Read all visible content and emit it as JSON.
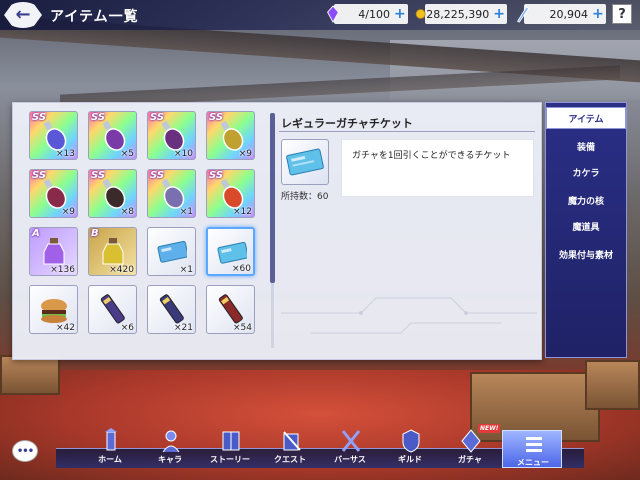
{
  "header": {
    "title": "アイテム一覧",
    "back_icon": "back-arrow-icon"
  },
  "resources": [
    {
      "icon": "crystal-icon",
      "value": "4/100",
      "color": "#8b4bff"
    },
    {
      "icon": "coin-icon",
      "value": "28,225,390",
      "color": "#f0c020"
    },
    {
      "icon": "gem-icon",
      "value": "20,904",
      "color": "#7fb0ff"
    }
  ],
  "help_label": "?",
  "grid": {
    "items": [
      {
        "rank": "SS",
        "qty": "×13",
        "bg": "rainbow",
        "art": "potion-ring"
      },
      {
        "rank": "SS",
        "qty": "×5",
        "bg": "rainbow",
        "art": "potion-wing"
      },
      {
        "rank": "SS",
        "qty": "×10",
        "bg": "rainbow",
        "art": "potion-sword"
      },
      {
        "rank": "SS",
        "qty": "×9",
        "bg": "rainbow",
        "art": "potion-orb"
      },
      {
        "rank": "SS",
        "qty": "×9",
        "bg": "rainbow",
        "art": "potion-staff"
      },
      {
        "rank": "SS",
        "qty": "×8",
        "bg": "rainbow",
        "art": "potion-dark"
      },
      {
        "rank": "SS",
        "qty": "×1",
        "bg": "rainbow",
        "art": "potion-silver"
      },
      {
        "rank": "SS",
        "qty": "×12",
        "bg": "rainbow",
        "art": "potion-red"
      },
      {
        "rank": "A",
        "qty": "×136",
        "bg": "purple",
        "art": "bottle-purple"
      },
      {
        "rank": "B",
        "qty": "×420",
        "bg": "gold",
        "art": "bottle-yellow"
      },
      {
        "rank": "",
        "qty": "×1",
        "bg": "plain",
        "art": "ticket-blue"
      },
      {
        "rank": "",
        "qty": "×60",
        "bg": "plain",
        "art": "ticket-cyan",
        "selected": true
      },
      {
        "rank": "",
        "qty": "×42",
        "bg": "plain",
        "art": "burger"
      },
      {
        "rank": "",
        "qty": "×6",
        "bg": "plain",
        "art": "tube-purple"
      },
      {
        "rank": "",
        "qty": "×21",
        "bg": "plain",
        "art": "tube-blue"
      },
      {
        "rank": "",
        "qty": "×54",
        "bg": "plain",
        "art": "tube-red"
      }
    ]
  },
  "detail": {
    "title": "レギュラーガチャチケット",
    "count": "所持数：60",
    "description": "ガチャを1回引くことができるチケット"
  },
  "tabs": [
    {
      "label": "アイテム",
      "active": true
    },
    {
      "label": "装備"
    },
    {
      "label": "カケラ"
    },
    {
      "label": "魔力の核"
    },
    {
      "label": "魔道具"
    },
    {
      "label": "効果付与素材"
    }
  ],
  "nav": [
    {
      "label": "ホーム",
      "icon": "tower-icon"
    },
    {
      "label": "キャラ",
      "icon": "character-icon"
    },
    {
      "label": "ストーリー",
      "icon": "book-icon"
    },
    {
      "label": "クエスト",
      "icon": "quest-icon"
    },
    {
      "label": "バーサス",
      "icon": "crossed-swords-icon"
    },
    {
      "label": "ギルド",
      "icon": "shield-icon"
    },
    {
      "label": "ガチャ",
      "icon": "gacha-icon",
      "badge": "NEW!"
    },
    {
      "label": "メニュー",
      "icon": "menu-icon",
      "active": true
    }
  ],
  "chat_label": "•••"
}
